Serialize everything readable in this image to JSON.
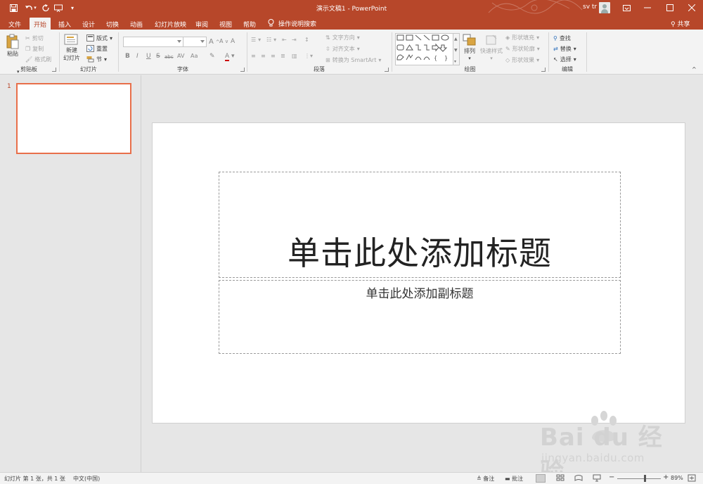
{
  "app": {
    "doc_title": "演示文稿1  -  PowerPoint",
    "user_name": "sv tr",
    "accent_color": "#b7472a",
    "thumb_border_color": "#e86f4a"
  },
  "quick_access": {
    "save_icon": "save-icon",
    "undo_icon": "undo-icon",
    "redo_icon": "redo-icon",
    "start_icon": "start-slideshow-icon",
    "customize_icon": "customize-qat-icon"
  },
  "window": {
    "ribbon_display_icon": "ribbon-display-options-icon",
    "minimize_icon": "minimize-icon",
    "restore_icon": "restore-icon",
    "close_icon": "close-icon"
  },
  "tabs": [
    {
      "label": "文件"
    },
    {
      "label": "开始"
    },
    {
      "label": "插入"
    },
    {
      "label": "设计"
    },
    {
      "label": "切换"
    },
    {
      "label": "动画"
    },
    {
      "label": "幻灯片放映"
    },
    {
      "label": "审阅"
    },
    {
      "label": "视图"
    },
    {
      "label": "帮助"
    }
  ],
  "tell_me": "操作说明搜索",
  "share": "共享",
  "ribbon": {
    "clipboard": {
      "label": "剪贴板",
      "paste": "粘贴",
      "cut": "剪切",
      "copy": "复制",
      "format_painter": "格式刷"
    },
    "slides": {
      "label": "幻灯片",
      "new_slide_line1": "新建",
      "new_slide_line2": "幻灯片",
      "layout": "版式",
      "reset": "重置",
      "section": "节"
    },
    "font": {
      "label": "字体",
      "bold": "B",
      "italic": "I",
      "underline": "U",
      "strike": "S",
      "shadow": "abc",
      "spacing": "AV",
      "case": "Aa",
      "grow": "A",
      "shrink": "A",
      "clear": "A",
      "color": "A"
    },
    "paragraph": {
      "label": "段落",
      "text_direction": "文字方向",
      "align_text": "对齐文本",
      "smartart": "转换为 SmartArt"
    },
    "drawing": {
      "label": "绘图",
      "arrange": "排列",
      "quick_styles": "快速样式",
      "shape_fill": "形状填充",
      "shape_outline": "形状轮廓",
      "shape_effects": "形状效果"
    },
    "editing": {
      "label": "编辑",
      "find": "查找",
      "replace": "替换",
      "select": "选择"
    }
  },
  "thumbnails": {
    "slide_number": "1"
  },
  "slide": {
    "title_placeholder": "单击此处添加标题",
    "subtitle_placeholder": "单击此处添加副标题"
  },
  "watermark": {
    "main": "Bai  du 经验",
    "url": "jingyan.baidu.com"
  },
  "status": {
    "slide_info": "幻灯片 第 1 张，共 1 张",
    "language": "中文(中国)",
    "notes": "备注",
    "comments": "批注",
    "zoom_minus": "−",
    "zoom_plus": "+",
    "zoom": "89%",
    "zoom_fraction": 0.63
  }
}
